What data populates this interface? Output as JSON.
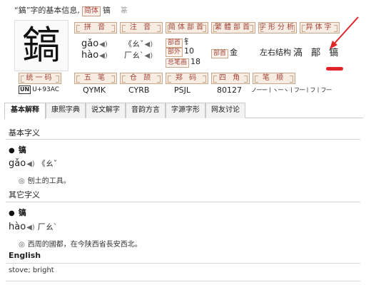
{
  "header": {
    "quoted_char": "“鎬”字的基本信息,",
    "simplified_tag": "简体",
    "char": "镐",
    "seal_label": "篆"
  },
  "big_char": "鎬",
  "sections": {
    "pinyin": "拼 音",
    "zhuyin": "注 音",
    "simple_radical": "简体部首",
    "trad_radical": "繁體部首",
    "structure": "字形分析",
    "variant": "异体字",
    "unicode": "统一码",
    "wubi": "五 笔",
    "cangjie": "仓 颉",
    "zhengma": "郑 码",
    "sijiao": "四 角",
    "stroke_order": "笔 顺"
  },
  "readings": [
    {
      "pinyin": "gǎo",
      "zhuyin": "《ㄠˇ"
    },
    {
      "pinyin": "hào",
      "zhuyin": "厂ㄠˋ"
    }
  ],
  "speaker_glyph": "◀)",
  "simple_radical": {
    "radical_label": "部首",
    "radical": "钅",
    "outer_label": "部外",
    "outer": "10",
    "total_label": "总笔画",
    "total": "18"
  },
  "trad_radical": {
    "label": "部首",
    "value": "金"
  },
  "structure_value": "左右结构",
  "variants": "滈 鄗 镐",
  "codes": {
    "unicode_badge": "UN",
    "unicode": "U+93AC",
    "wubi": "QYMK",
    "cangjie": "CYRB",
    "zhengma": "PSJL",
    "sijiao": "80127",
    "stroke_order": "ノ一ー丨ヽ一ヽ丨フ一丨フ丨フ一"
  },
  "tabs": [
    "基本解释",
    "康熙字典",
    "说文解字",
    "音韵方言",
    "字源字形",
    "网友讨论"
  ],
  "basic": {
    "title": "基本字义",
    "char": "镐",
    "pinyin": "gǎo",
    "zhuyin": "《ㄠˇ",
    "definition": "刨土的工具。"
  },
  "other": {
    "title": "其它字义",
    "char": "镐",
    "pinyin": "hào",
    "zhuyin": "厂ㄠˋ",
    "definition": "西周的國都，在今陕西省長安西北。"
  },
  "english": {
    "title": "English",
    "text": "stove; bright"
  },
  "bullet": "●",
  "def_marker": "◎",
  "accent_color": "#a3453a",
  "highlight_color": "#e0242a"
}
